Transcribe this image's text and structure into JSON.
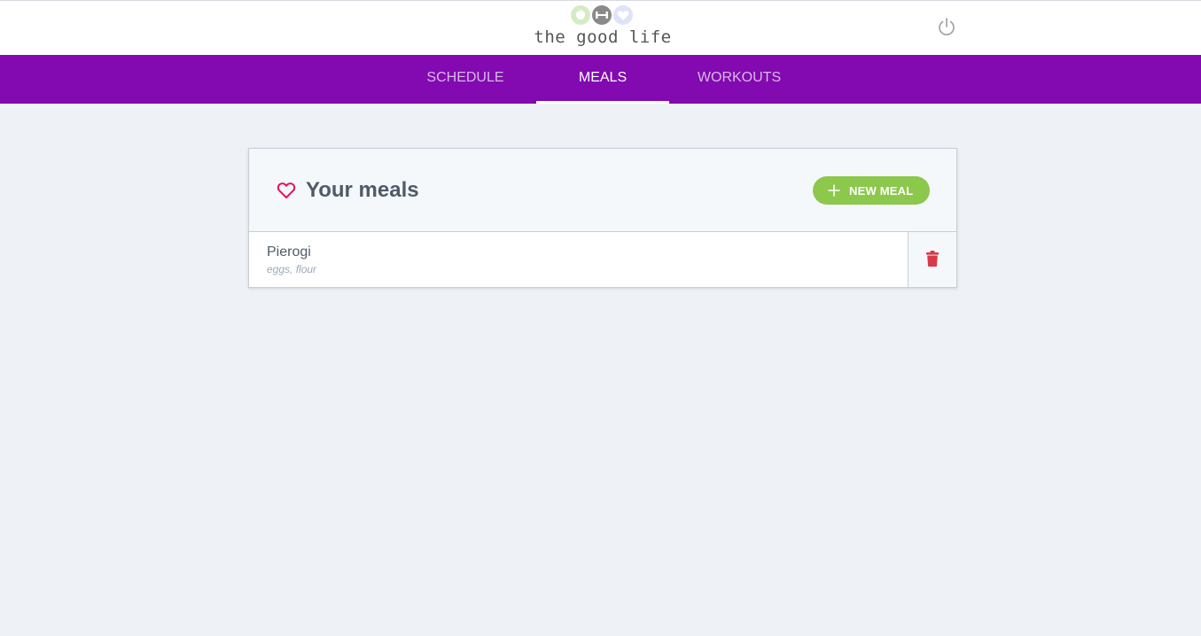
{
  "header": {
    "logo_text": "the good life",
    "logo_icons": [
      "apple-icon",
      "dumbbell-icon",
      "heart-icon"
    ],
    "power_icon": "power-icon"
  },
  "nav": {
    "tabs": [
      {
        "label": "SCHEDULE",
        "active": false
      },
      {
        "label": "MEALS",
        "active": true
      },
      {
        "label": "WORKOUTS",
        "active": false
      }
    ]
  },
  "meals": {
    "title": "Your meals",
    "title_icon": "heart-outline-icon",
    "new_button_label": "NEW MEAL",
    "items": [
      {
        "name": "Pierogi",
        "ingredients": "eggs, flour"
      }
    ]
  },
  "colors": {
    "nav_background": "#820ab0",
    "accent_green": "#8cc84b",
    "heart": "#e0115f",
    "delete": "#d83a4a",
    "page_background": "#eef2f6"
  }
}
